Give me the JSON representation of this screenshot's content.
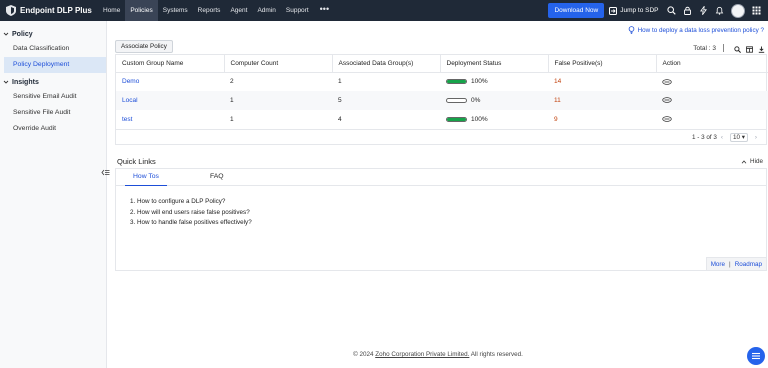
{
  "brand": {
    "name": "Endpoint DLP Plus"
  },
  "nav": {
    "items": [
      {
        "label": "Home",
        "active": false
      },
      {
        "label": "Policies",
        "active": true
      },
      {
        "label": "Systems",
        "active": false
      },
      {
        "label": "Reports",
        "active": false
      },
      {
        "label": "Agent",
        "active": false
      },
      {
        "label": "Admin",
        "active": false
      },
      {
        "label": "Support",
        "active": false
      }
    ],
    "more": "•••"
  },
  "topbar": {
    "download_label": "Download Now",
    "jump_label": "Jump to SDP",
    "icons": [
      "search-icon",
      "lock-icon",
      "bolt-icon",
      "bell-icon",
      "avatar",
      "apps-icon"
    ]
  },
  "sidebar": {
    "sections": [
      {
        "title": "Policy",
        "items": [
          {
            "label": "Data Classification",
            "active": false
          },
          {
            "label": "Policy Deployment",
            "active": true
          }
        ]
      },
      {
        "title": "Insights",
        "items": [
          {
            "label": "Sensitive Email Audit",
            "active": false
          },
          {
            "label": "Sensitive File Audit",
            "active": false
          },
          {
            "label": "Override Audit",
            "active": false
          }
        ]
      }
    ]
  },
  "main": {
    "help_link": "How to deploy a data loss prevention policy ?",
    "associate_button": "Associate Policy",
    "total_label": "Total : 3",
    "table": {
      "columns": [
        "Custom Group Name",
        "Computer Count",
        "Associated Data Group(s)",
        "Deployment Status",
        "False Positive(s)",
        "Action"
      ],
      "rows": [
        {
          "name": "Demo",
          "computers": "2",
          "data_groups": "1",
          "status": "100%",
          "progress": 1.0,
          "false_positives": "14"
        },
        {
          "name": "Local",
          "computers": "1",
          "data_groups": "5",
          "status": "0%",
          "progress": 0.0,
          "false_positives": "11"
        },
        {
          "name": "test",
          "computers": "1",
          "data_groups": "4",
          "status": "100%",
          "progress": 1.0,
          "false_positives": "9"
        }
      ]
    },
    "pager": {
      "range": "1 - 3 of 3",
      "per_page": "10"
    }
  },
  "quick_links": {
    "title": "Quick Links",
    "hide_label": "Hide",
    "tabs": [
      {
        "label": "How Tos",
        "active": true
      },
      {
        "label": "FAQ",
        "active": false
      }
    ],
    "items": [
      "1. How to configure a DLP Policy?",
      "2. How will end users raise false positives?",
      "3. How to handle false positives effectively?"
    ],
    "more_label": "More",
    "roadmap_label": "Roadmap"
  },
  "footer": {
    "prefix": "© 2024 ",
    "company": "Zoho Corporation Private Limited.",
    "suffix": " All rights reserved."
  },
  "colors": {
    "topbar": "#1f2937",
    "accent": "#2563eb",
    "progress": "#16a34a",
    "false_positive": "#c2410c"
  }
}
